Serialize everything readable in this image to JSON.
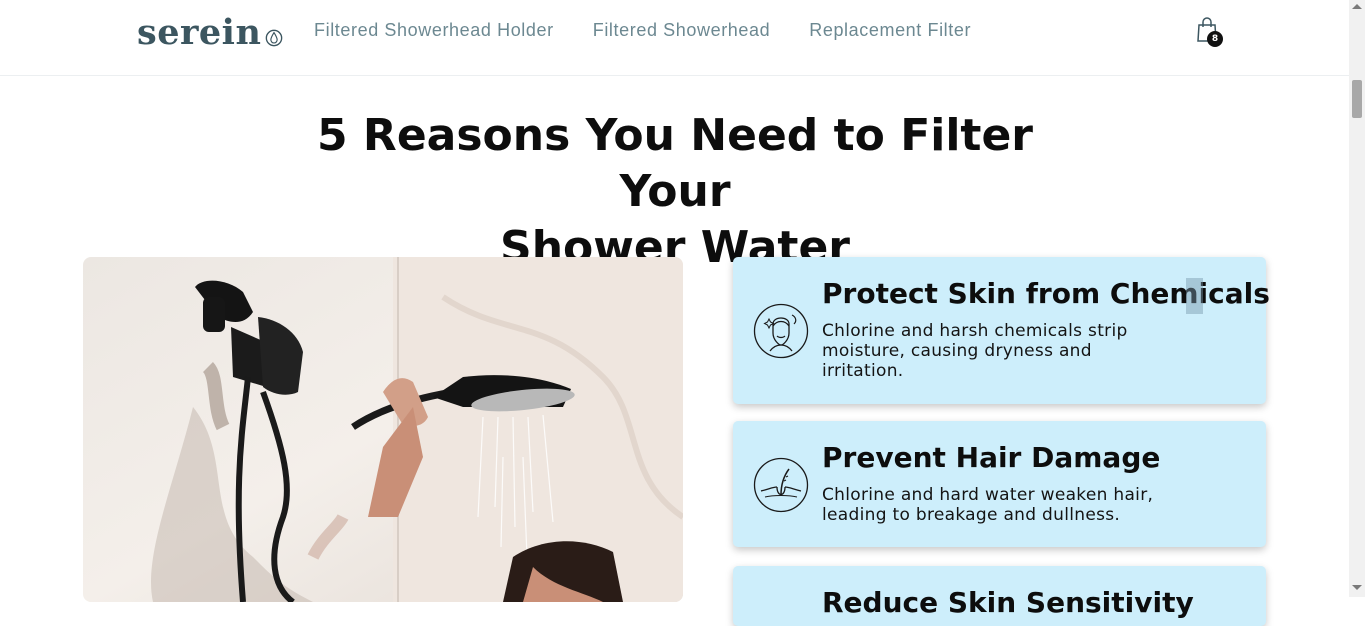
{
  "header": {
    "logo_text": "serein",
    "nav": [
      {
        "label": "Filtered Showerhead Holder"
      },
      {
        "label": "Filtered Showerhead"
      },
      {
        "label": "Replacement Filter"
      }
    ],
    "cart_count": "8"
  },
  "main": {
    "title_line1": "5 Reasons You Need to Filter Your",
    "title_line2": "Shower Water",
    "reasons": [
      {
        "title": "Protect Skin from Chemicals",
        "description": "Chlorine and harsh chemicals strip moisture, causing dryness and irritation.",
        "icon": "face-skin-icon"
      },
      {
        "title": "Prevent Hair Damage",
        "description": "Chlorine and hard water weaken hair, leading to breakage and dullness.",
        "icon": "hair-follicle-icon"
      },
      {
        "title": "Reduce Skin Sensitivity",
        "description": "",
        "icon": ""
      }
    ]
  },
  "colors": {
    "brand": "#3c5660",
    "nav_text": "#6c8891",
    "card_background": "#cdeefb",
    "title_text": "#0d0d0d"
  }
}
